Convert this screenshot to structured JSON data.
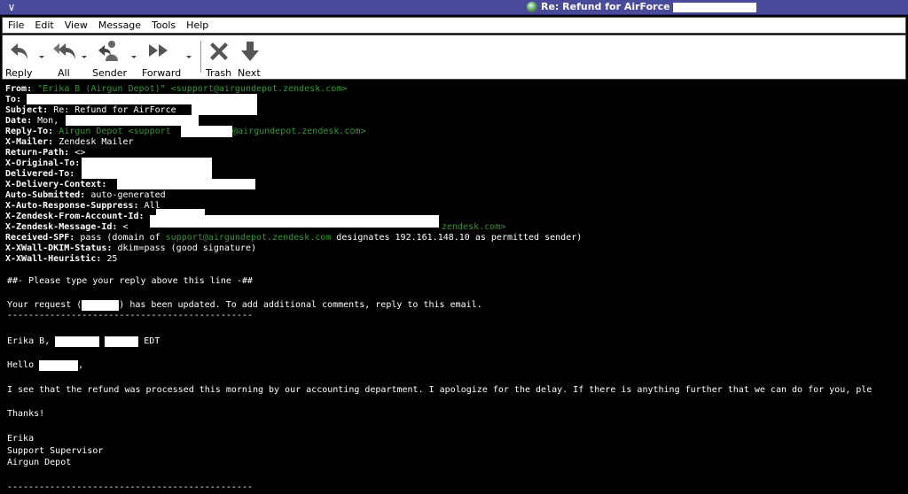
{
  "window": {
    "title": "Re: Refund for AirForce"
  },
  "menu": [
    "File",
    "Edit",
    "View",
    "Message",
    "Tools",
    "Help"
  ],
  "toolbar": {
    "reply": "Reply",
    "all": "All",
    "sender": "Sender",
    "forward": "Forward",
    "trash": "Trash",
    "next": "Next"
  },
  "headers": {
    "from_label": "From:",
    "from_value": "\"Erika B (Airgun Depot)\" <support@airgundepot.zendesk.com>",
    "to_label": "To:",
    "subject_label": "Subject:",
    "subject_value": "Re: Refund for AirForce",
    "date_label": "Date:",
    "date_value": "Mon,",
    "replyto_label": "Reply-To:",
    "replyto_value_a": "Airgun Depot <support",
    "replyto_value_b": "@airgundepot.zendesk.com>",
    "xmailer_label": "X-Mailer:",
    "xmailer_value": "Zendesk Mailer",
    "returnpath_label": "Return-Path:",
    "returnpath_value": "<>",
    "xorigto_label": "X-Original-To:",
    "deliveredto_label": "Delivered-To:",
    "xdelivctx_label": "X-Delivery-Context:",
    "autosub_label": "Auto-Submitted:",
    "autosub_value": "auto-generated",
    "xautoresp_label": "X-Auto-Response-Suppress:",
    "xautoresp_value": "All",
    "xzfrom_label": "X-Zendesk-From-Account-Id:",
    "xzmsg_label": "X-Zendesk-Message-Id:",
    "xzmsg_value_a": "<",
    "xzmsg_value_b": "zendesk.com>",
    "spf_label": "Received-SPF:",
    "spf_value_a": "pass (domain of ",
    "spf_value_b": "support@airgundepot.zendesk.com",
    "spf_value_c": " designates 192.161.148.10 as permitted sender)",
    "dkim_label": "X-XWall-DKIM-Status:",
    "dkim_value": "dkim=pass (good signature)",
    "heur_label": "X-XWall-Heuristic:",
    "heur_value": "25"
  },
  "body": {
    "line_reply_above": "##- Please type your reply above this line -##",
    "line_request_a": "Your request (",
    "line_request_b": ") has been updated. To add additional comments, reply to this email.",
    "divider": "----------------------------------------------",
    "line_author_a": "Erika B,",
    "line_author_b": "EDT",
    "line_hello_a": "Hello",
    "line_hello_b": ",",
    "line_refund": "I see that the refund was processed this morning by our accounting department. I apologize for the delay. If there is anything further that we can do for you, ple",
    "line_thanks": "Thanks!",
    "sig_name": "Erika",
    "sig_title": "Support Supervisor",
    "sig_company": "Airgun Depot",
    "divider_bottom": "----------------------------------------------"
  },
  "colors": {
    "title_bar": "#4a4a9a",
    "link_green": "#2c9a2c"
  }
}
